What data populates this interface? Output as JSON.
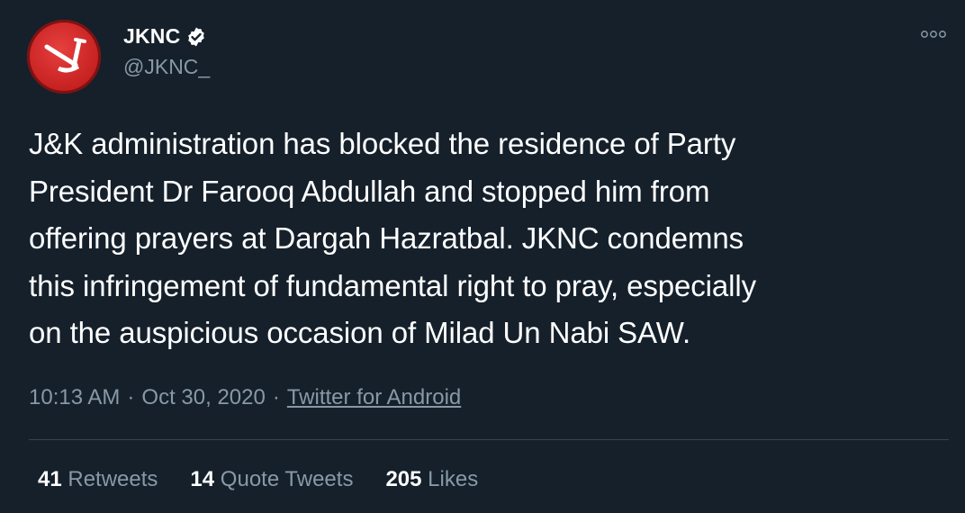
{
  "author": {
    "display_name": "JKNC",
    "handle": "@JKNC_",
    "verified": true,
    "avatar_icon": "plough-icon"
  },
  "tweet": {
    "text": "J&K administration has blocked the residence of Party\nPresident Dr Farooq Abdullah and stopped him from\noffering prayers at Dargah Hazratbal. JKNC condemns\nthis infringement of fundamental right to pray, especially\non the auspicious occasion of Milad Un Nabi SAW."
  },
  "meta": {
    "time": "10:13 AM",
    "separator": "·",
    "date": "Oct 30, 2020",
    "source": "Twitter for Android"
  },
  "stats": {
    "retweets_count": "41",
    "retweets_label": "Retweets",
    "quotes_count": "14",
    "quotes_label": "Quote Tweets",
    "likes_count": "205",
    "likes_label": "Likes"
  },
  "colors": {
    "background": "#15202b",
    "secondary_text": "#8899a6",
    "avatar_red": "#d12a29",
    "divider": "#38444d"
  }
}
